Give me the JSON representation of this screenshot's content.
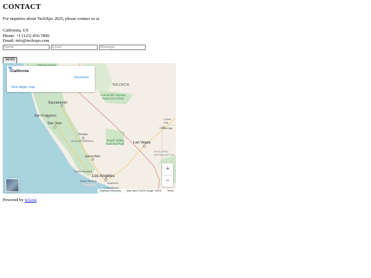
{
  "page": {
    "title": "CONTACT",
    "intro": "For inquiries about TechXpo 2025, please contact us at",
    "location": "California, US",
    "phone": "Phone: +1 (123) 456-7890",
    "email": "Email: info@techxpo.com"
  },
  "form": {
    "name_placeholder": "Name",
    "email_placeholder": "Email",
    "message_placeholder": "Message",
    "send_label": "SEND"
  },
  "map": {
    "place_title": "California",
    "directions_label": "Directions",
    "view_larger": "View larger map",
    "zoom_in": "+",
    "zoom_out": "−",
    "google_logo": "Google",
    "attribution": {
      "shortcuts": "Keyboard shortcuts",
      "data": "Map data ©2025 Google, INEGI",
      "terms": "Terms"
    },
    "labels": {
      "nevada": "NEVADA",
      "california": "CALIFORNIA",
      "sacramento": "Sacramento",
      "san_francisco": "San Francisco",
      "san_jose": "San Jose",
      "fresno": "Fresno",
      "bakersfield": "Bakersfield",
      "los_angeles": "Los Angeles",
      "santa_barbara": "Santa Barbara",
      "santa_monica": "Santa Monica",
      "long_beach": "Long Beach",
      "anaheim": "Anaheim",
      "las_vegas": "Las Vegas",
      "st_george": "St. George",
      "cedar_city": "Cedar City",
      "humboldt": "Humboldt-Toiyabe\nNational Forest",
      "death_valley": "Death Valley\nNational Park",
      "hualapai": "HUALAPAI\nRESERVATION",
      "national_forest": "National Forest"
    },
    "colors": {
      "water": "#a8d3df",
      "land": "#f3efe6",
      "green": "#c6e2c3",
      "border": "#d08a7a"
    }
  },
  "footer": {
    "powered_prefix": "Powered by",
    "powered_link": "w3.css"
  }
}
